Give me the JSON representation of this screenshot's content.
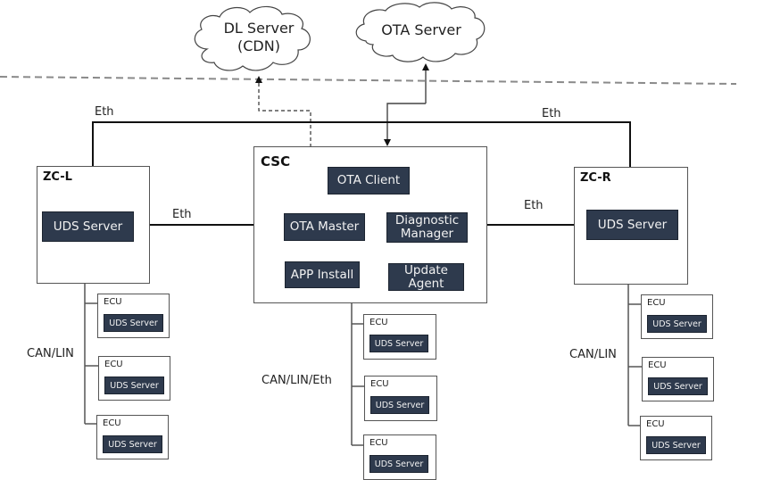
{
  "clouds": {
    "dl_server": {
      "line1": "DL Server",
      "line2": "(CDN)"
    },
    "ota_server": {
      "label": "OTA Server"
    }
  },
  "csc": {
    "title": "CSC",
    "modules": {
      "ota_client": "OTA Client",
      "ota_master": "OTA Master",
      "diagnostic_manager": "Diagnostic Manager",
      "app_install": "APP Install",
      "update_agent": "Update Agent"
    }
  },
  "zc_left": {
    "title": "ZC-L",
    "module": "UDS Server"
  },
  "zc_right": {
    "title": "ZC-R",
    "module": "UDS Server"
  },
  "links": {
    "eth_top_left": "Eth",
    "eth_top_right": "Eth",
    "eth_left": "Eth",
    "eth_right": "Eth",
    "bus_left": "CAN/LIN",
    "bus_center": "CAN/LIN/Eth",
    "bus_right": "CAN/LIN"
  },
  "ecu_groups": {
    "left": [
      {
        "label": "ECU",
        "module": "UDS Server"
      },
      {
        "label": "ECU",
        "module": "UDS Server"
      },
      {
        "label": "ECU",
        "module": "UDS Server"
      }
    ],
    "center": [
      {
        "label": "ECU",
        "module": "UDS Server"
      },
      {
        "label": "ECU",
        "module": "UDS Server"
      },
      {
        "label": "ECU",
        "module": "UDS Server"
      }
    ],
    "right": [
      {
        "label": "ECU",
        "module": "UDS Server"
      },
      {
        "label": "ECU",
        "module": "UDS Server"
      },
      {
        "label": "ECU",
        "module": "UDS Server"
      }
    ]
  }
}
